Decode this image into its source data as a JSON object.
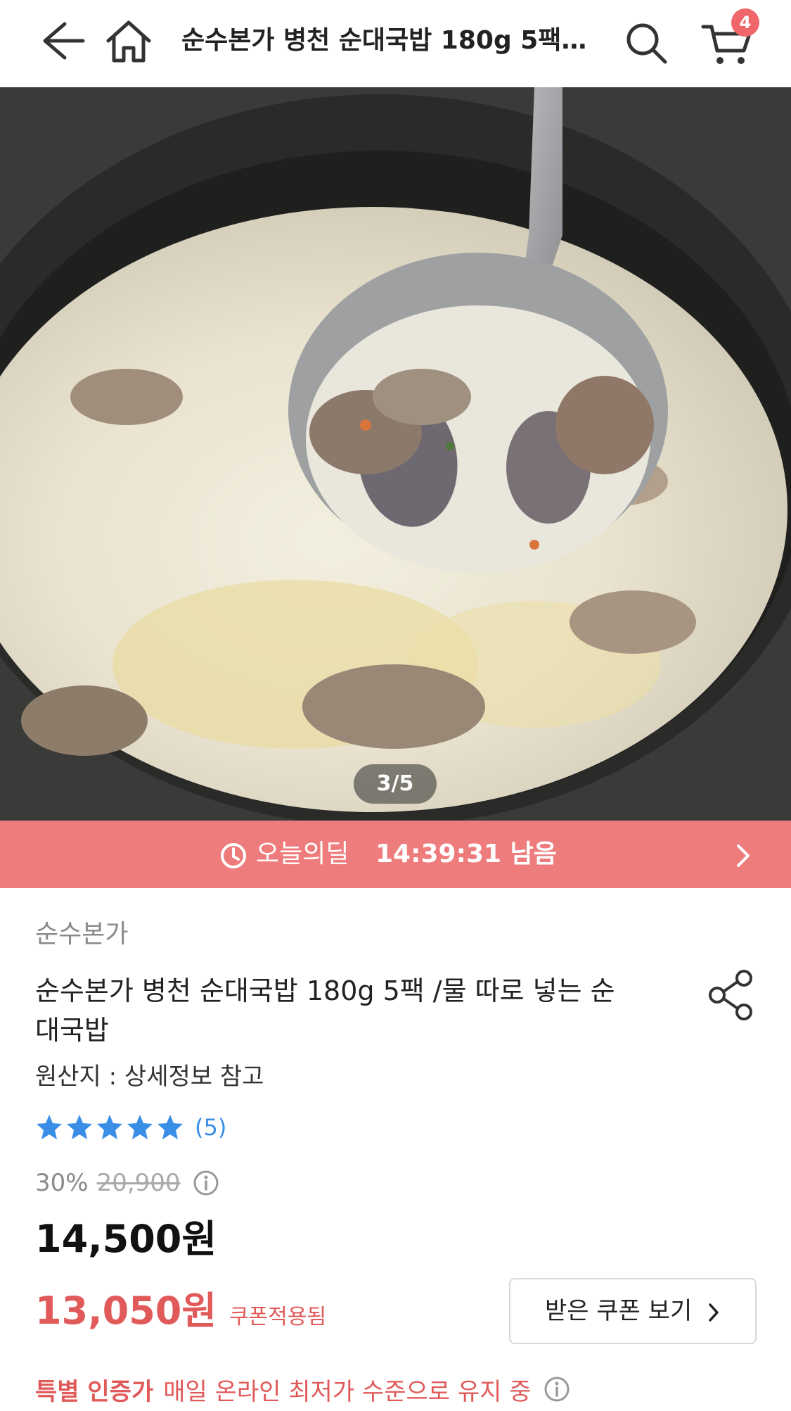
{
  "header": {
    "title": "순수본가 병천 순대국밥 180g 5팩 /물 따로 넣는 순대국밥",
    "cart_count": "4"
  },
  "gallery": {
    "counter": "3/5"
  },
  "deal": {
    "label": "오늘의딜",
    "time_remaining": "14:39:31 남음"
  },
  "product": {
    "brand": "순수본가",
    "name": "순수본가 병천 순대국밥 180g 5팩 /물 따로 넣는 순대국밥",
    "origin": "원산지 : 상세정보 참고",
    "rating_stars": 5,
    "review_count": "(5)",
    "discount_rate": "30%",
    "original_price": "20,900",
    "price": "14,500원",
    "coupon_price": "13,050원",
    "coupon_tag": "쿠폰적용됨",
    "coupon_button": "받은 쿠폰 보기",
    "special_badge": "특별 인증가",
    "special_text": "매일 온라인 최저가 수준으로 유지 중"
  },
  "colors": {
    "deal_bar": "#ee7c7c",
    "accent_red": "#e15a5a",
    "star_blue": "#3a8ee6",
    "badge": "#f0666a"
  },
  "icons": {
    "back": "arrow-left-icon",
    "home": "home-icon",
    "search": "search-icon",
    "cart": "cart-icon",
    "clock": "clock-icon",
    "share": "share-icon",
    "info": "info-icon"
  }
}
